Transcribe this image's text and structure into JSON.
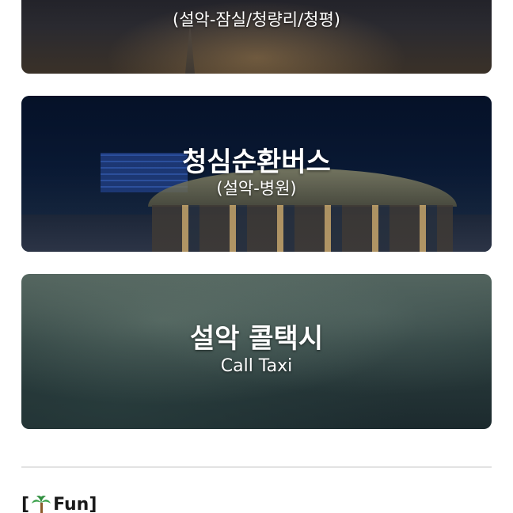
{
  "cards": [
    {
      "title": "",
      "subtitle": "(설악-잠실/청량리/청평)"
    },
    {
      "title": "청심순환버스",
      "subtitle": "(설악-병원)"
    },
    {
      "title": "설악 콜택시",
      "subtitle": "Call Taxi"
    }
  ],
  "section": {
    "bracket_open": "[",
    "icon": "palm-tree-icon",
    "label": "Fun",
    "bracket_close": "]"
  }
}
